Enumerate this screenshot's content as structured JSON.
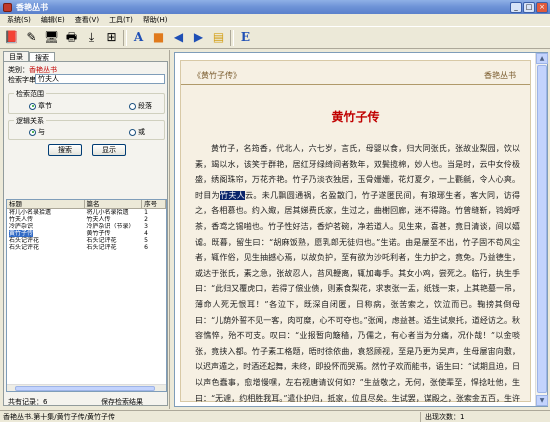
{
  "window": {
    "title": "香艳丛书"
  },
  "menu": [
    "系统(S)",
    "编辑(E)",
    "查看(V)",
    "工具(T)",
    "帮助(H)"
  ],
  "toolbar": {
    "icons": [
      "book-icon",
      "edit-icon",
      "computer-icon",
      "print-icon",
      "download-icon",
      "tree-icon",
      "font-icon",
      "bookmark-icon",
      "back-icon",
      "forward-icon",
      "folder-icon",
      "e-icon"
    ],
    "e_label": "E"
  },
  "left": {
    "tabs": [
      "目录",
      "搜索"
    ],
    "category_label": "类别：",
    "category_value": "香艳丛书",
    "keyword_label": "检索字串：",
    "keyword_value": "竹夫人",
    "scope": {
      "legend": "检索范围",
      "options": [
        "章节",
        "段落"
      ],
      "selected": "章节"
    },
    "logic": {
      "legend": "逻辑关系",
      "options": [
        "与",
        "或"
      ],
      "selected": "与"
    },
    "search_button": "搜索",
    "show_button": "显示",
    "table": {
      "headers": [
        "标题",
        "篇名",
        "序号"
      ],
      "rows": [
        [
          "将儿小名录拾遗",
          "将儿小名录拾遗",
          "1"
        ],
        [
          "竹夫人传",
          "竹夫人传",
          "2"
        ],
        [
          "冷庐杂识",
          "冷庐杂识（节录）",
          "3"
        ],
        [
          "黄竹子传",
          "黄竹子传",
          "4"
        ],
        [
          "右头记评花",
          "右头记评花",
          "5"
        ],
        [
          "右头记评花",
          "右头记评花",
          "6"
        ]
      ],
      "selected_index": 3
    },
    "count_label": "共有记录：6",
    "save_label": "保存检索结果"
  },
  "reader": {
    "book_title": "《黄竹子传》",
    "series": "香艳丛书",
    "chapter_title": "黄竹子传",
    "text_before": "黄竹子，名筠香，代北人，六七岁，言氏，母婴以食，归大同张氏，张故业梨园，饮以素，竭以水，该笑于群艳，居红牙绿绮间者数年，双鬓揽棉，妙人也。当是时，云中女伶极盛，绣阁珠帘，万花齐艳。竹子乃淡衣独居，玉骨姗姗，花灯夏夕，一上氍毹，令人心爽。时目为",
    "text_highlight": "竹夫人",
    "text_after": "云。未几飘圆通祸，名盈散门，竹子遂匿民间，有琅琊生者，客大同，访得之，各相慕也。约入娵，居其娣费氏家，生过之，曲榭回廊，迷不得路。竹曾缝靳，鸨姆呼茶，香鸢之锡啪也。竹子性好洁，香炉茗碗，净若道人。见生来，喜甚，竟日清谈，间以嬉谑。既暮，留生曰：“胡麻饭熟，愿乳郎无徒归也。”生诺。由是屡至不出，竹子固不苟风尘者，辄作俗，见生抽撼心焉，以故负护，至有欲为沙吒利者，生力护之，竟免。乃益德生，或达于张氏，素之急，张故忍人，苔风鞭离，辄加毒手。其女小鸡，尝死之。临行，执生手曰：“此归又覆虎口，若得了偿业债，则素食梨花，求衷张一盂，纸钱一束，上其艳墓一吊，薄命人死无恨耳！”各泣下，既深自闭匿，日称病，张苦索之，饮泣而已。鞠搒其倒母曰：“儿荫外誓不见一客，肉可糜，心不可夺也。”张闻，虑益甚。适生试泉托，道经访之。秋容憔悴，殆不可支。叹曰：“业报暂向簸穑，乃儒之，有心者当为分痛，况仆哉！”以金啖张，竟挟入都。竹子素工格题，晤时徐依曲，袁怒顾视，至是乃更为吴声，生母屡宙向敷，以迟声遁之，时酒还起舞，未终，即投怀而哭焉。然竹子欢而能书，语生曰：“试期且迫，日以声色蠢事，愈增慢嘿，左右视唐请议何如？”生益敬之，无何，张使辈至，悍捻吐他，生曰：“无遽，约相胜我耳。”遣仆护归，抵家，位且尽矣。生试罢，谋殿之，张索金五百，生许之，而措于其烦。次日，张作书相讹"
  },
  "status": {
    "location": "香艳丛书.第十集/黄竹子传/黄竹子传",
    "count": "出现次数：1"
  }
}
